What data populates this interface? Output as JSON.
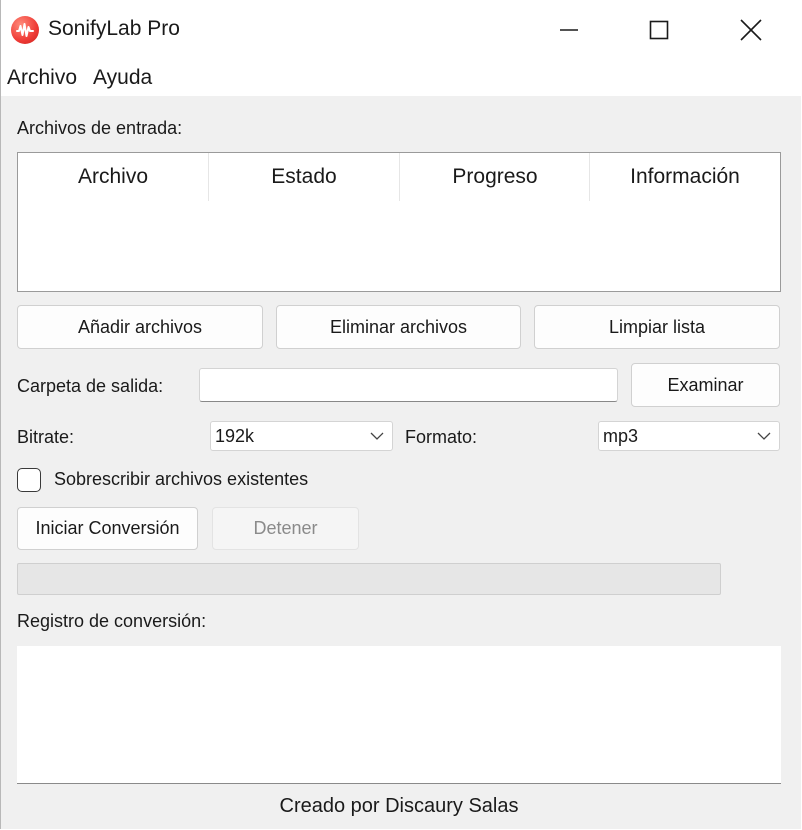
{
  "window": {
    "title": "SonifyLab Pro",
    "logo": "music-wave-icon",
    "accent": "#ef3b36"
  },
  "menu": {
    "items": [
      "Archivo",
      "Ayuda"
    ]
  },
  "input_section": {
    "label": "Archivos de entrada:",
    "columns": [
      "Archivo",
      "Estado",
      "Progreso",
      "Información"
    ],
    "rows": []
  },
  "file_buttons": {
    "add": "Añadir archivos",
    "remove": "Eliminar archivos",
    "clear": "Limpiar lista"
  },
  "output": {
    "label": "Carpeta de salida:",
    "value": "",
    "browse_label": "Examinar"
  },
  "settings": {
    "bitrate_label": "Bitrate:",
    "bitrate_value": "192k",
    "format_label": "Formato:",
    "format_value": "mp3"
  },
  "overwrite": {
    "label": "Sobrescribir archivos existentes",
    "checked": false
  },
  "actions": {
    "start": "Iniciar Conversión",
    "stop": "Detener",
    "stop_enabled": false
  },
  "progress": {
    "value": 0
  },
  "log": {
    "label": "Registro de conversión:",
    "content": ""
  },
  "footer": {
    "text": "Creado por Discaury Salas"
  }
}
